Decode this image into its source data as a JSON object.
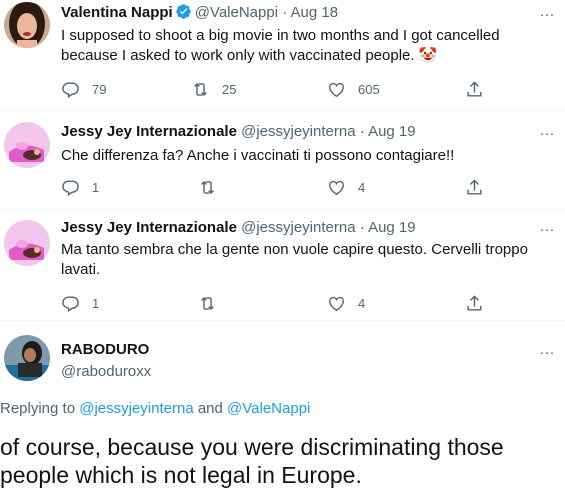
{
  "tweets": [
    {
      "name": "Valentina Nappi",
      "handle": "@ValeNappi",
      "date": "· Aug 18",
      "text": "I supposed to shoot a big movie in two months and I got cancelled because I asked to work only with vaccinated people. 🤡",
      "replies": "79",
      "retweets": "25",
      "likes": "605"
    },
    {
      "name": "Jessy Jey Internazionale",
      "handle": "@jessyjeyinterna",
      "date": "· Aug 19",
      "text": "Che differenza fa? Anche i vaccinati ti possono contagiare!!",
      "replies": "1",
      "retweets": "",
      "likes": "4"
    },
    {
      "name": "Jessy Jey Internazionale",
      "handle": "@jessyjeyinterna",
      "date": "· Aug 19",
      "text": "Ma tanto sembra che la gente non vuole capire questo. Cervelli troppo lavati.",
      "replies": "1",
      "retweets": "",
      "likes": "4"
    }
  ],
  "main": {
    "name": "RABODURO",
    "handle": "@raboduroxx",
    "replying_prefix": "Replying to ",
    "replying_user1": "@jessyjeyinterna",
    "replying_and": " and ",
    "replying_user2": "@ValeNappi",
    "text": "of course, because you were discriminating those people which is not legal in Europe."
  },
  "more_glyph": "···",
  "colors": {
    "accent": "#1d9bf0",
    "secondary": "#536471",
    "text": "#0f1419"
  }
}
